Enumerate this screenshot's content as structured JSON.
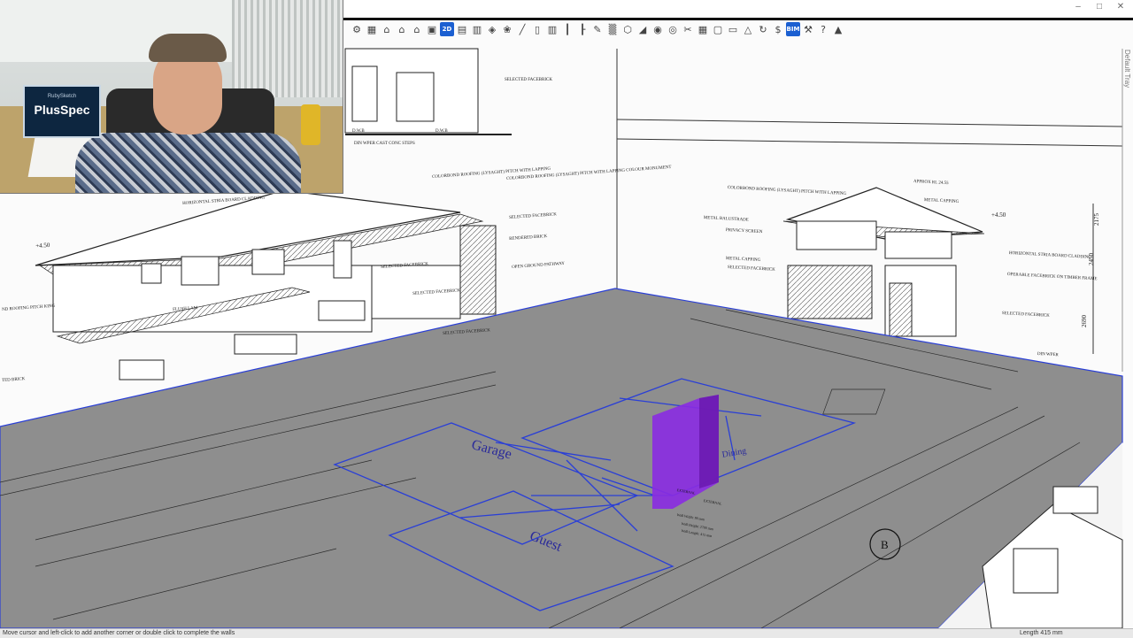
{
  "window": {
    "controls": [
      "–",
      "□",
      "✕"
    ]
  },
  "toolbar": {
    "tools": [
      {
        "name": "ruby-sketch-icon",
        "glyph": "⚙"
      },
      {
        "name": "box-icon",
        "glyph": "▦"
      },
      {
        "name": "home-icon",
        "glyph": "⌂"
      },
      {
        "name": "house-outline-icon",
        "glyph": "⌂"
      },
      {
        "name": "roof-icon",
        "glyph": "⌂"
      },
      {
        "name": "building-icon",
        "glyph": "▣"
      },
      {
        "name": "2d-mode-icon",
        "glyph": "2D",
        "blue": true
      },
      {
        "name": "truck-icon",
        "glyph": "▤"
      },
      {
        "name": "cabinet-icon",
        "glyph": "▥"
      },
      {
        "name": "layers-icon",
        "glyph": "◈"
      },
      {
        "name": "paint-icon",
        "glyph": "❀"
      },
      {
        "name": "brush-icon",
        "glyph": "╱"
      },
      {
        "name": "door-icon",
        "glyph": "▯"
      },
      {
        "name": "window-frame-icon",
        "glyph": "▥"
      },
      {
        "name": "column-icon",
        "glyph": "┃"
      },
      {
        "name": "stair-icon",
        "glyph": "┠"
      },
      {
        "name": "pencil-icon",
        "glyph": "✎"
      },
      {
        "name": "fence-icon",
        "glyph": "▒"
      },
      {
        "name": "hexagon-icon",
        "glyph": "⬡"
      },
      {
        "name": "slope-icon",
        "glyph": "◢"
      },
      {
        "name": "camera-icon",
        "glyph": "◉"
      },
      {
        "name": "target-icon",
        "glyph": "◎"
      },
      {
        "name": "cut-icon",
        "glyph": "✂"
      },
      {
        "name": "grid-icon",
        "glyph": "▦"
      },
      {
        "name": "crop-icon",
        "glyph": "▢"
      },
      {
        "name": "car-icon",
        "glyph": "▭"
      },
      {
        "name": "landscape-icon",
        "glyph": "△"
      },
      {
        "name": "refresh-icon",
        "glyph": "↻"
      },
      {
        "name": "dollar-icon",
        "glyph": "$"
      },
      {
        "name": "bim-mep-icon",
        "glyph": "BIM",
        "blue": true
      },
      {
        "name": "tools-icon",
        "glyph": "⚒"
      },
      {
        "name": "help-icon",
        "glyph": "?"
      },
      {
        "name": "graduation-cap-icon",
        "glyph": "▲"
      }
    ]
  },
  "tray": {
    "label": "Default Tray"
  },
  "webcam": {
    "logo_top": "RubySketch",
    "logo_main": "PlusSpec"
  },
  "drawing": {
    "elev_left_labels": [
      "HORIZONTAL STRIA BOARD CLADDING",
      "COLORBOND ROOFING (LYSAGHT) PITCH WITH LAPPING",
      "COLORBOND ROOFING (LYSAGHT) PITCH WITH LAPPING COLOUR MONUMENT",
      "SELECTED FACEBRICK",
      "RENDERED BRICK",
      "OPEN GROUND PATHWAY",
      "SELECTED FACEBRICK",
      "ND ROOFING PITCH KING",
      "TED BRICK",
      "FLUSH LAM",
      "SELECTED FACEBRICK",
      "SELECTED FACEBRICK"
    ],
    "elev_top_labels": [
      "SELECTED FACEBRICK",
      "DIN WPER CAST CONC STEPS",
      "D.W.B",
      "D.W.B"
    ],
    "elev_right_labels": [
      "APPROX RL 24.55",
      "METAL CAPPING",
      "COLORBOND ROOFING (LYSAGHT) PITCH WITH LAPPING",
      "HORIZONTAL STRIA BOARD CLADDING",
      "OPERABLE FACEBRICK ON TIMBER FRAME",
      "SELECTED FACEBRICK",
      "METAL BALUSTRADE",
      "PRIVACY SCREEN",
      "METAL CAPPING",
      "SELECTED FACEBRICK",
      "DIN WPER"
    ],
    "dims_right": [
      "2175",
      "2450",
      "2690"
    ],
    "levels": [
      "+4.50",
      "+4.50"
    ],
    "room_labels": [
      "Garage",
      "Guest",
      "Dining"
    ],
    "tooltip": [
      "EXTERNAL",
      "EXTERNAL",
      "Wall Width: 90 mm",
      "Wall Height: 2700 mm",
      "Wall Length: 415 mm"
    ],
    "bubble": "B"
  },
  "colors": {
    "wall_preview": "#8a2be2",
    "plan_lines": "#2a3fd6",
    "sheet_grey": "#8e8e8e"
  },
  "status": {
    "message": "Move cursor and left-click to add another corner or double click to complete the walls",
    "measurement": "Length  415 mm"
  }
}
